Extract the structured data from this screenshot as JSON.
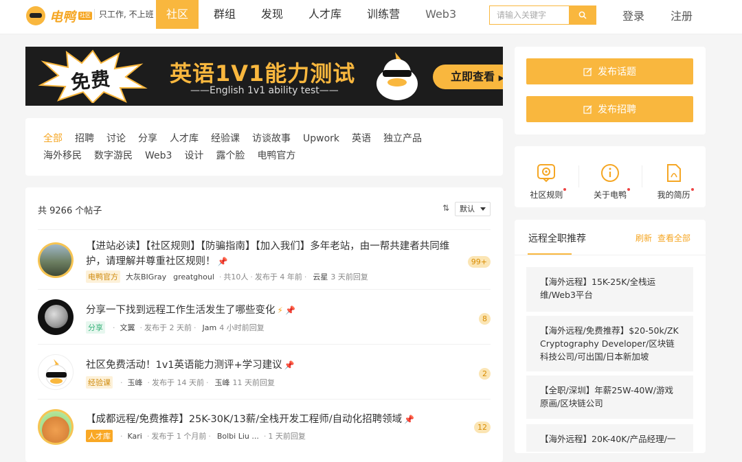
{
  "header": {
    "logo_text": "电鸭",
    "logo_badge": "社区",
    "slogan": "只工作, 不上班",
    "nav": [
      {
        "label": "社区",
        "active": true
      },
      {
        "label": "群组"
      },
      {
        "label": "发现"
      },
      {
        "label": "人才库"
      },
      {
        "label": "训练营"
      },
      {
        "label": "Web3"
      }
    ],
    "search_placeholder": "请输入关键字",
    "login": "登录",
    "register": "注册"
  },
  "banner": {
    "free": "免费",
    "title": "英语1V1能力测试",
    "subtitle": "——English 1v1 ability test——",
    "button": "立即查看"
  },
  "tags": [
    "全部",
    "招聘",
    "讨论",
    "分享",
    "人才库",
    "经验课",
    "访谈故事",
    "Upwork",
    "英语",
    "独立产品",
    "海外移民",
    "数字游民",
    "Web3",
    "设计",
    "露个脸",
    "电鸭官方"
  ],
  "posts_header": {
    "count_text": "共 9266 个帖子",
    "sort": "默认"
  },
  "posts": [
    {
      "title": "【进站必读】【社区规则】【防骗指南】【加入我们】多年老站，由一帮共建者共同维护，请理解并尊重社区规则！",
      "tag": "电鸭官方",
      "author": "大灰BIGray",
      "coauthor": "greatghoul",
      "extra": "共10人",
      "posted": "发布于 4 年前",
      "replier": "云星",
      "replied": "3 天前回复",
      "count": "99+"
    },
    {
      "title": "分享一下找到远程工作生活发生了哪些变化",
      "tag": "分享",
      "author": "文翼",
      "posted": "发布于 2 天前",
      "replier": "Jam",
      "replied": "4 小时前回复",
      "count": "8"
    },
    {
      "title": "社区免费活动！1v1英语能力测评+学习建议",
      "tag": "经验课",
      "author": "玉峰",
      "posted": "发布于 14 天前",
      "replier": "玉峰",
      "replied": "11 天前回复",
      "count": "2"
    },
    {
      "title": "【成都远程/免费推荐】25K-30K/13薪/全栈开发工程师/自动化招聘领域",
      "tag": "人才库",
      "author": "Kari",
      "posted": "发布于 1 个月前",
      "replier": "Bolbi Liu ...",
      "replied": "1 天前回复",
      "count": "12"
    }
  ],
  "side": {
    "post_topic": "发布话题",
    "post_job": "发布招聘",
    "links": [
      "社区规则",
      "关于电鸭",
      "我的简历"
    ],
    "jobs_title": "远程全职推荐",
    "refresh": "刷新",
    "view_all": "查看全部",
    "jobs": [
      "【海外远程】15K-25K/全栈运维/Web3平台",
      "【海外远程/免费推荐】$20-50k/ZK Cryptography Developer/区块链科技公司/可出国/日本新加坡",
      "【全职/深圳】年薪25W-40W/游戏原画/区块链公司",
      "【海外远程】20K-40K/产品经理/一"
    ]
  },
  "colors": {
    "accent": "#f9b73e",
    "accent_text": "#f5a623"
  }
}
